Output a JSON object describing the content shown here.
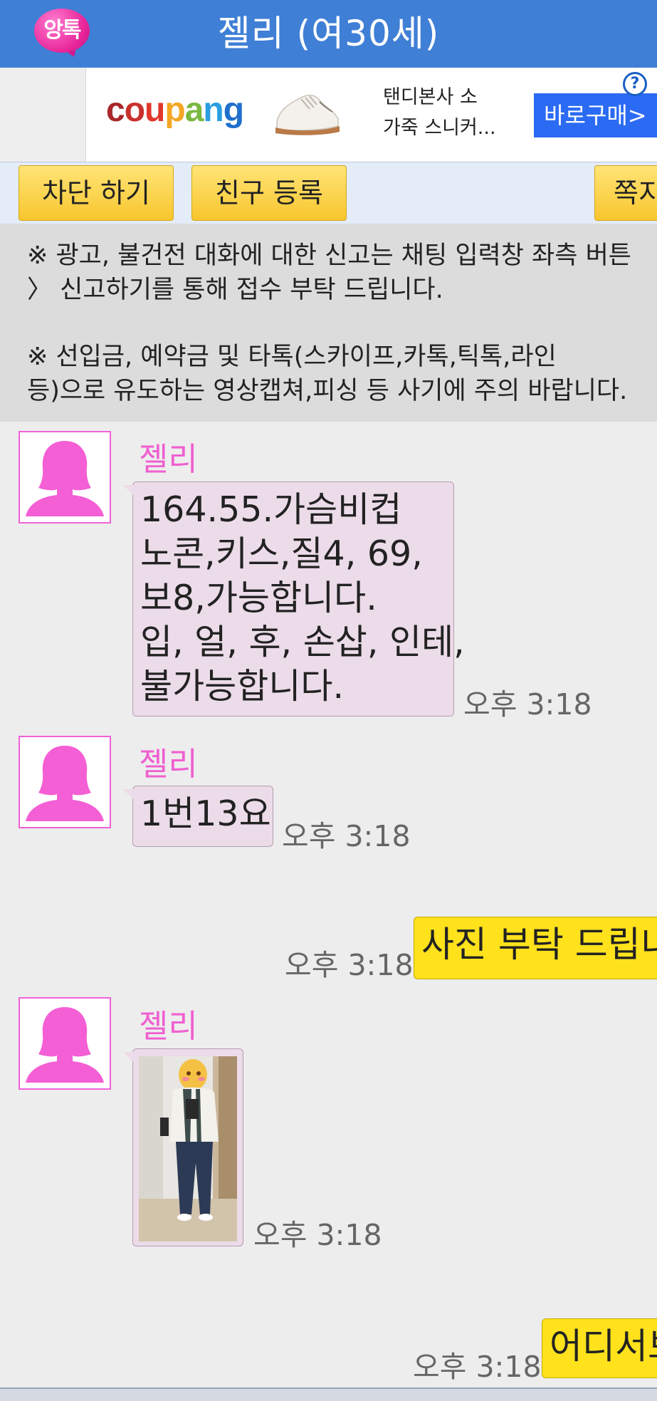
{
  "header": {
    "title": "젤리 (여30세)",
    "logo_text": "앙톡"
  },
  "ad": {
    "brand": "coupang",
    "brand_colors": [
      "#a8272a",
      "#e1372b",
      "#f5a623",
      "#7bb842",
      "#2a9ee0",
      "#1f6fcc"
    ],
    "line1": "탠디본사 소",
    "line2": "가죽 스니커...",
    "buy_label": "바로구매>",
    "help_icon": "question-circle-icon"
  },
  "actions": {
    "block": "차단 하기",
    "friend": "친구 등록",
    "note": "쪽지"
  },
  "notice": {
    "line1": "※ 광고, 불건전 대화에 대한 신고는 채팅 입력창 좌측 버튼",
    "line2": "〉 신고하기를 통해 접수 부탁 드립니다.",
    "line3": "※ 선입금, 예약금 및 타톡(스카이프,카톡,틱톡,라인",
    "line4": "등)으로 유도하는 영상캡쳐,피싱 등 사기에 주의 바랍니다."
  },
  "messages": {
    "m1": {
      "sender": "젤리",
      "line1": "164.55.가슴비컵",
      "line2": "노콘,키스,질4, 69,",
      "line3": "보8,가능합니다.",
      "line4": "입, 얼, 후, 손삽, 인테,",
      "line5": "불가능합니다.",
      "time": "오후 3:18"
    },
    "m2": {
      "sender": "젤리",
      "text": "1번13요",
      "time": "오후 3:18"
    },
    "m3": {
      "text": "사진 부탁 드립니다",
      "time": "오후 3:18"
    },
    "m4": {
      "sender": "젤리",
      "time": "오후 3:18"
    },
    "m5": {
      "text": "어디서보나요",
      "time": "오후 3:18"
    }
  },
  "colors": {
    "header": "#3f7fd6",
    "incoming_bubble": "#ecdce9",
    "outgoing_bubble": "#ffe21c",
    "sender_name": "#f060d0",
    "action_button": "#f8c62e",
    "buy_button": "#2b6bf3"
  }
}
